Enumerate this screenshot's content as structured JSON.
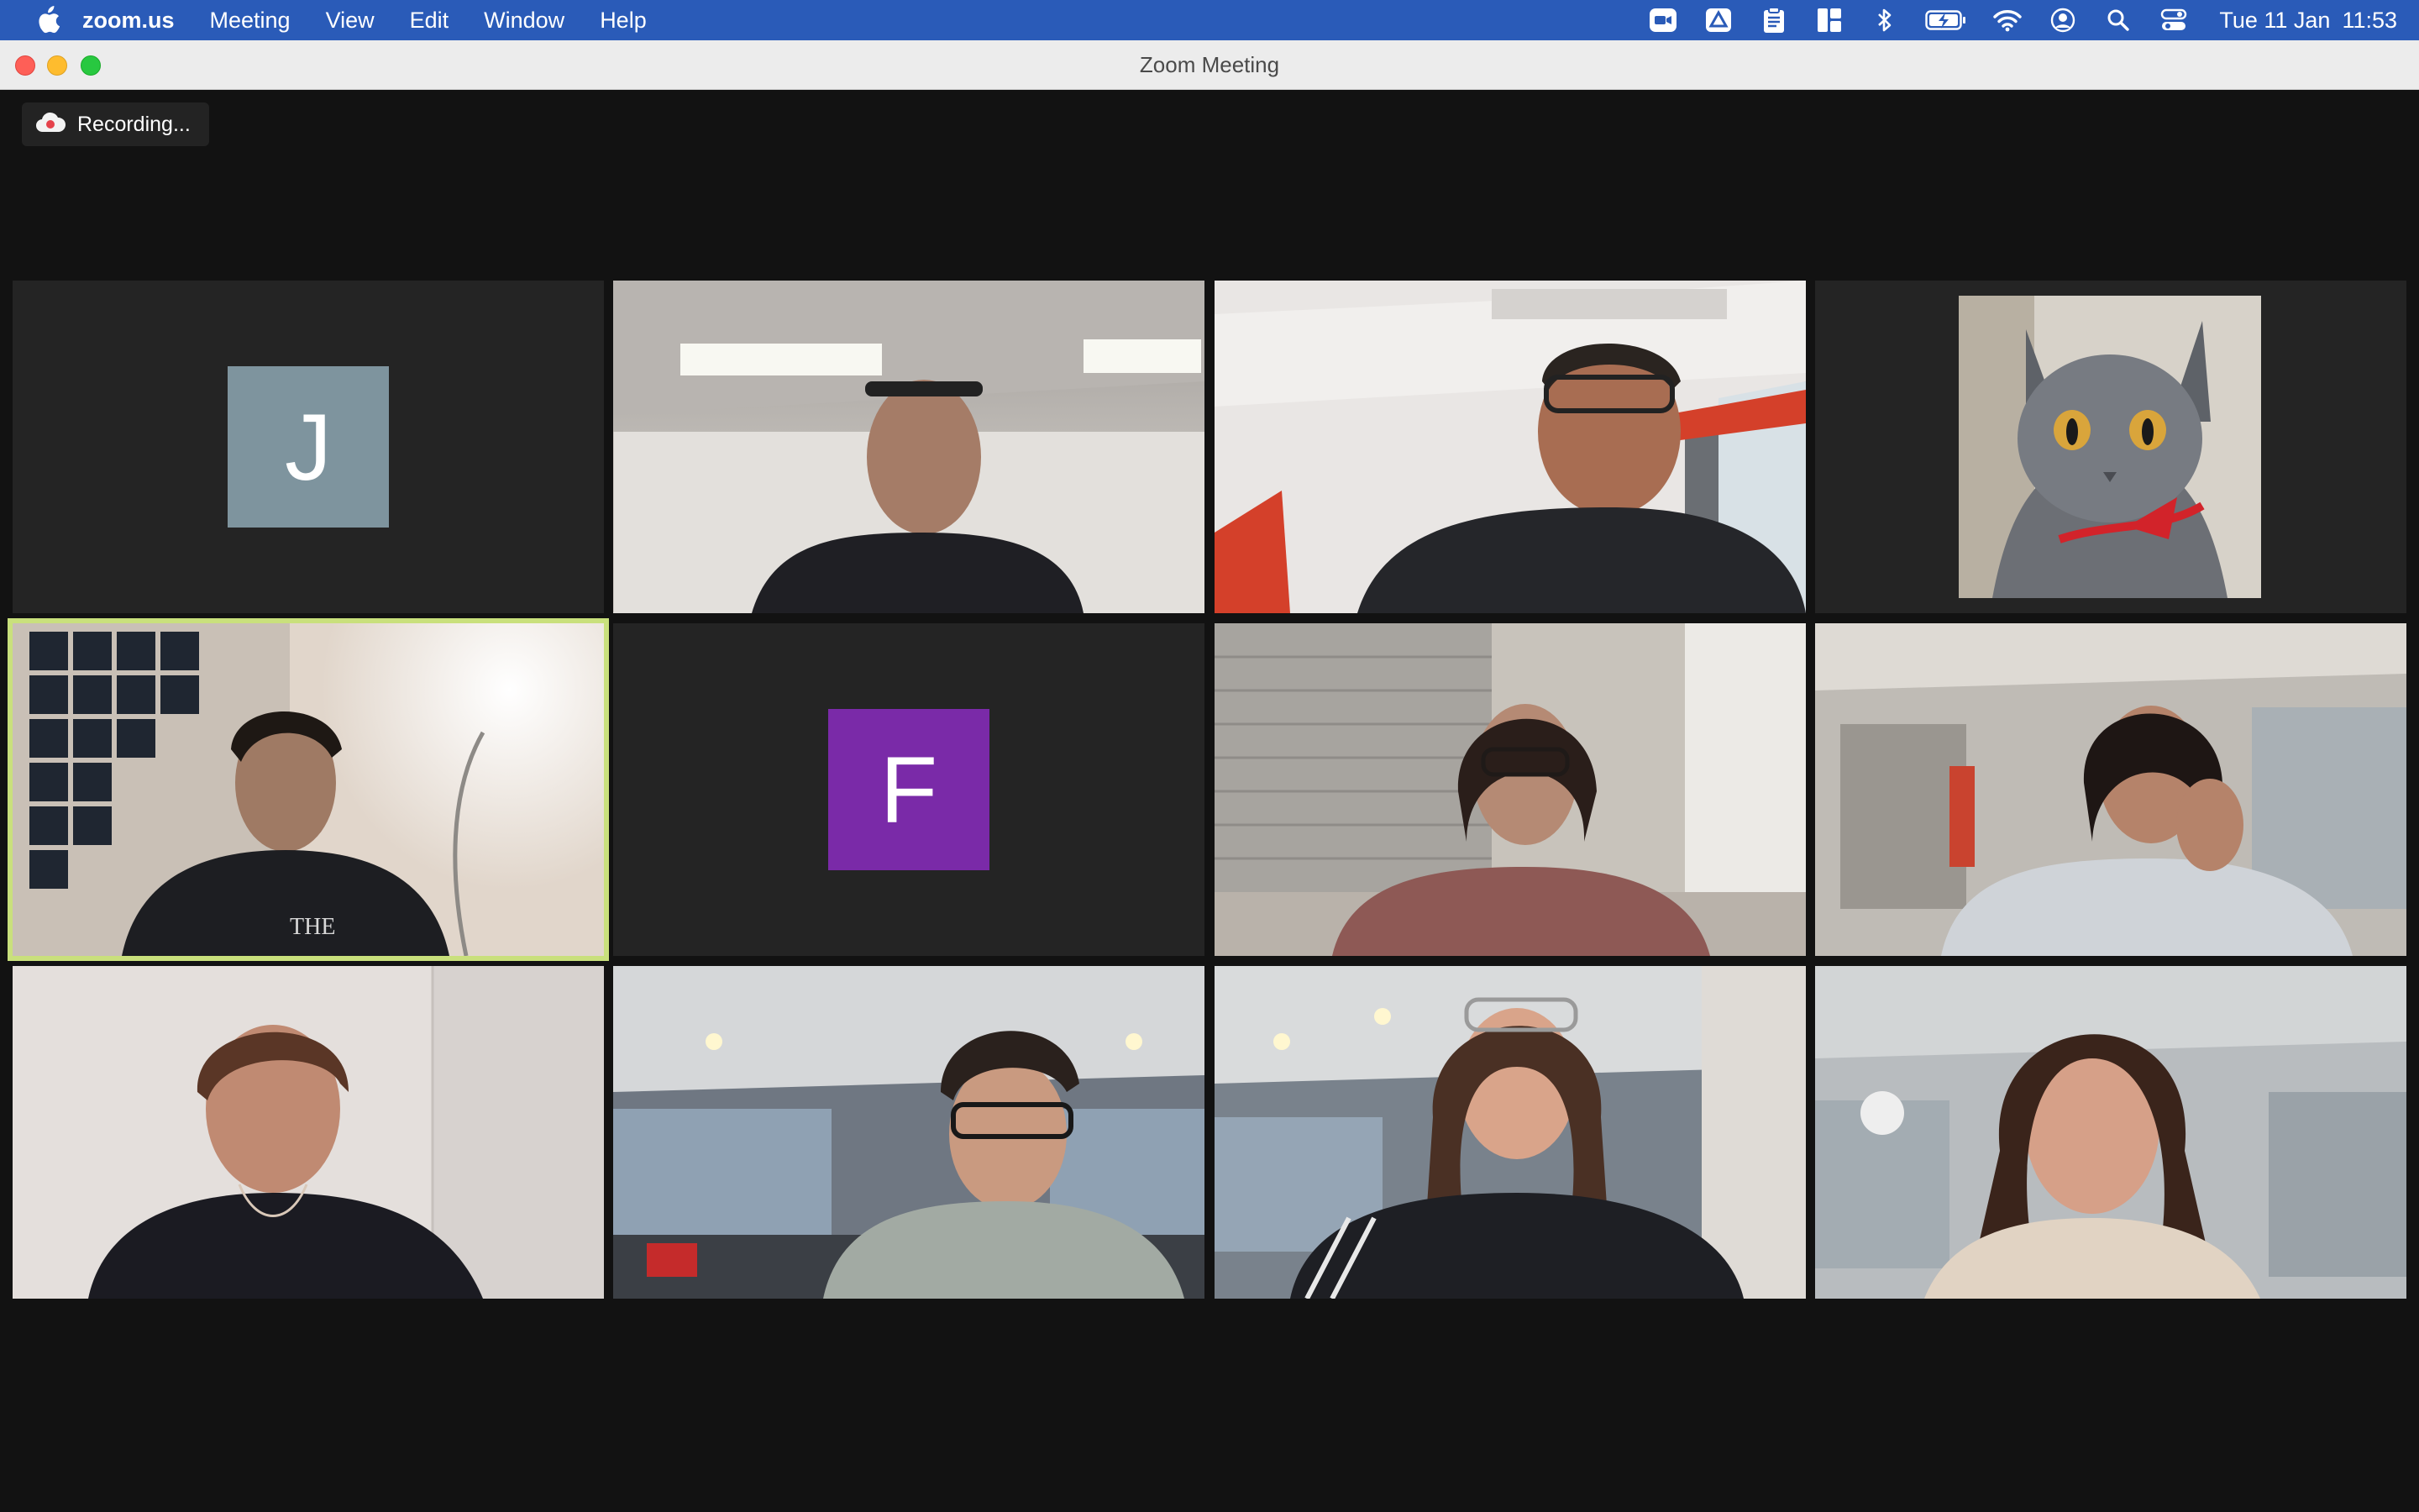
{
  "menubar": {
    "app_name": "zoom.us",
    "menus": [
      "Meeting",
      "View",
      "Edit",
      "Window",
      "Help"
    ],
    "status_icons": [
      "zoom-video-icon",
      "drive-icon",
      "clipboard-icon",
      "layout-icon",
      "bluetooth-icon",
      "battery-charging-icon",
      "wifi-icon",
      "user-account-icon",
      "spotlight-search-icon",
      "control-center-icon"
    ],
    "clock": {
      "date": "Tue 11 Jan",
      "time": "11:53"
    }
  },
  "window": {
    "title": "Zoom Meeting"
  },
  "recording": {
    "label": "Recording..."
  },
  "colors": {
    "menubar": "#2a5bb8",
    "active_speaker_border": "#c9e07c",
    "avatar_j": "#7e949e",
    "avatar_f": "#7a2aa8",
    "recording_dot": "#e5424b"
  },
  "participants": {
    "j": {
      "initial": "J"
    },
    "f": {
      "initial": "F"
    }
  }
}
